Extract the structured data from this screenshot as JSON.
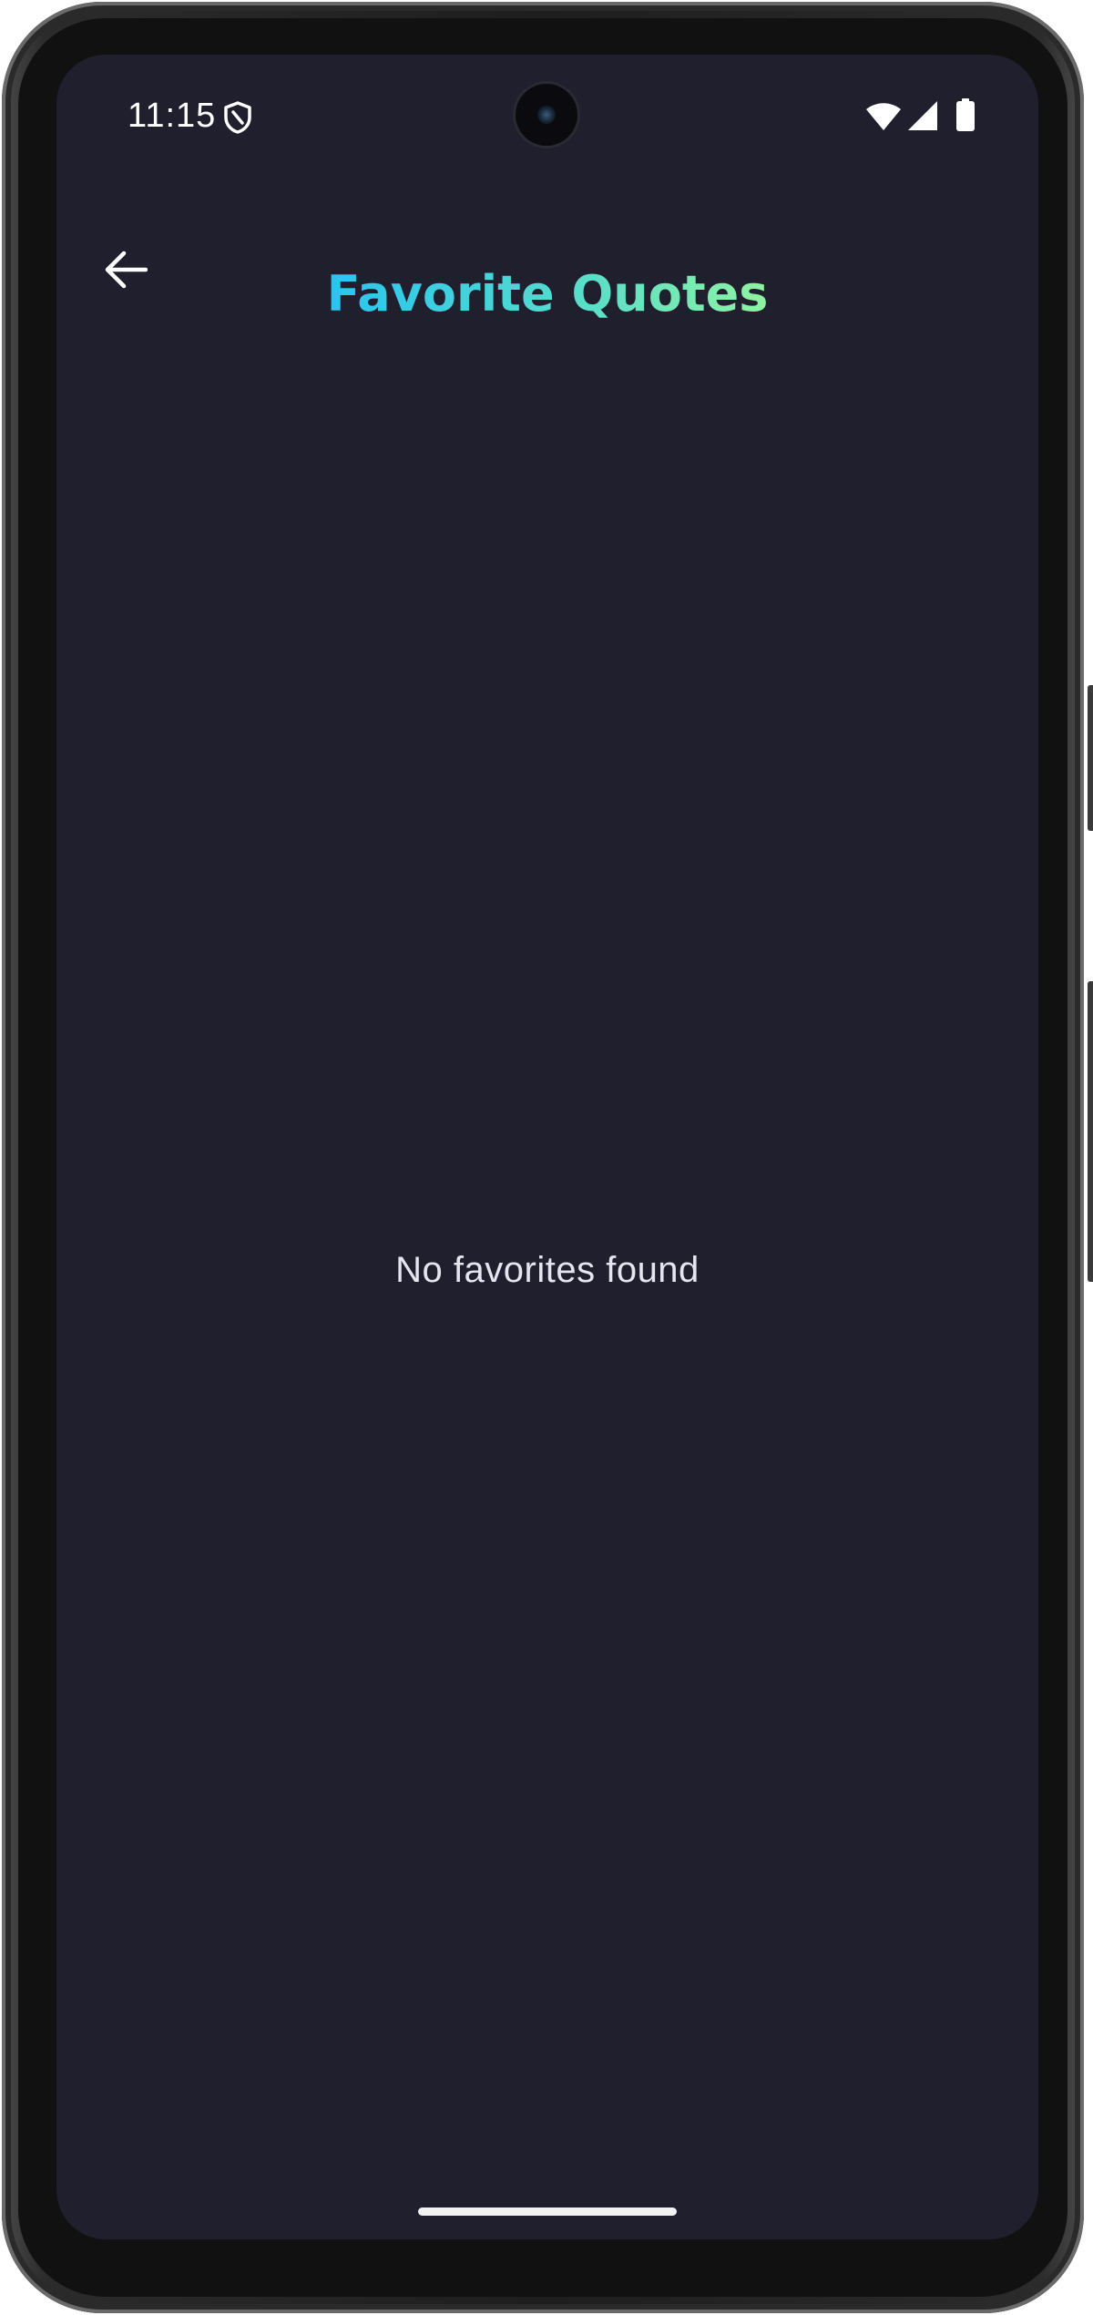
{
  "status_bar": {
    "time": "11:15",
    "icons": [
      "shield-icon",
      "wifi-icon",
      "signal-icon",
      "battery-icon"
    ]
  },
  "app_bar": {
    "title": "Favorite Quotes",
    "back_icon": "arrow-left-icon",
    "title_gradient": [
      "#29c4f0",
      "#55dccd",
      "#8ff2a2"
    ]
  },
  "main": {
    "empty_message": "No favorites found"
  },
  "colors": {
    "background": "#1f1f2d",
    "text": "#e6e4ee"
  }
}
